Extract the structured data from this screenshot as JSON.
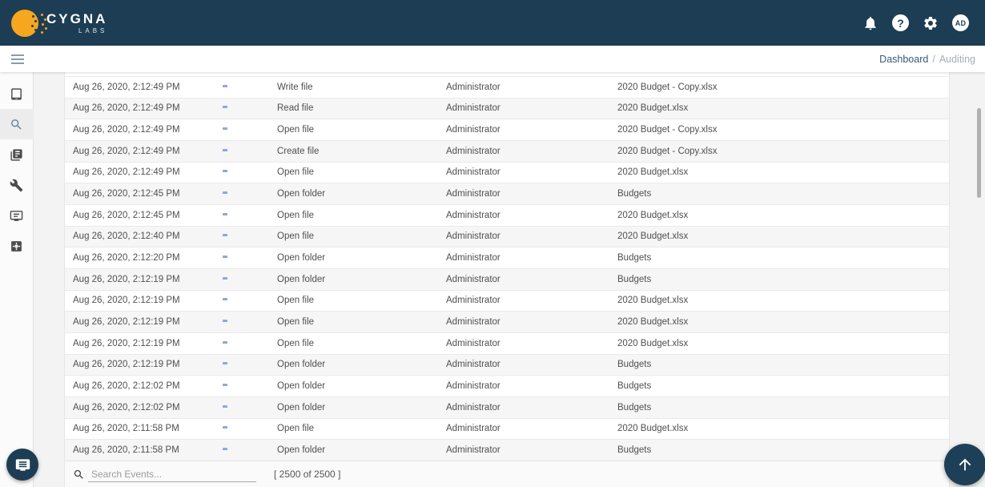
{
  "brand": {
    "primary": "CYGNA",
    "secondary": "LABS"
  },
  "topbar": {
    "help_glyph": "?",
    "avatar_label": "AD"
  },
  "breadcrumb": {
    "parent": "Dashboard",
    "separator": "/",
    "current": "Auditing"
  },
  "sidebar": {
    "items": [
      {
        "name": "devices",
        "active": false
      },
      {
        "name": "search",
        "active": true
      },
      {
        "name": "documents",
        "active": false
      },
      {
        "name": "tools",
        "active": false
      },
      {
        "name": "console",
        "active": false
      },
      {
        "name": "apps",
        "active": false
      }
    ]
  },
  "events": {
    "rows": [
      {
        "time": "Aug 26, 2020, 2:12:49 PM",
        "action": "Write file",
        "user": "Administrator",
        "target": "2020 Budget - Copy.xlsx"
      },
      {
        "time": "Aug 26, 2020, 2:12:49 PM",
        "action": "Read file",
        "user": "Administrator",
        "target": "2020 Budget.xlsx"
      },
      {
        "time": "Aug 26, 2020, 2:12:49 PM",
        "action": "Open file",
        "user": "Administrator",
        "target": "2020 Budget - Copy.xlsx"
      },
      {
        "time": "Aug 26, 2020, 2:12:49 PM",
        "action": "Create file",
        "user": "Administrator",
        "target": "2020 Budget - Copy.xlsx"
      },
      {
        "time": "Aug 26, 2020, 2:12:49 PM",
        "action": "Open file",
        "user": "Administrator",
        "target": "2020 Budget.xlsx"
      },
      {
        "time": "Aug 26, 2020, 2:12:45 PM",
        "action": "Open folder",
        "user": "Administrator",
        "target": "Budgets"
      },
      {
        "time": "Aug 26, 2020, 2:12:45 PM",
        "action": "Open file",
        "user": "Administrator",
        "target": "2020 Budget.xlsx"
      },
      {
        "time": "Aug 26, 2020, 2:12:40 PM",
        "action": "Open file",
        "user": "Administrator",
        "target": "2020 Budget.xlsx"
      },
      {
        "time": "Aug 26, 2020, 2:12:20 PM",
        "action": "Open folder",
        "user": "Administrator",
        "target": "Budgets"
      },
      {
        "time": "Aug 26, 2020, 2:12:19 PM",
        "action": "Open folder",
        "user": "Administrator",
        "target": "Budgets"
      },
      {
        "time": "Aug 26, 2020, 2:12:19 PM",
        "action": "Open file",
        "user": "Administrator",
        "target": "2020 Budget.xlsx"
      },
      {
        "time": "Aug 26, 2020, 2:12:19 PM",
        "action": "Open file",
        "user": "Administrator",
        "target": "2020 Budget.xlsx"
      },
      {
        "time": "Aug 26, 2020, 2:12:19 PM",
        "action": "Open file",
        "user": "Administrator",
        "target": "2020 Budget.xlsx"
      },
      {
        "time": "Aug 26, 2020, 2:12:19 PM",
        "action": "Open folder",
        "user": "Administrator",
        "target": "Budgets"
      },
      {
        "time": "Aug 26, 2020, 2:12:02 PM",
        "action": "Open folder",
        "user": "Administrator",
        "target": "Budgets"
      },
      {
        "time": "Aug 26, 2020, 2:12:02 PM",
        "action": "Open folder",
        "user": "Administrator",
        "target": "Budgets"
      },
      {
        "time": "Aug 26, 2020, 2:11:58 PM",
        "action": "Open file",
        "user": "Administrator",
        "target": "2020 Budget.xlsx"
      },
      {
        "time": "Aug 26, 2020, 2:11:58 PM",
        "action": "Open folder",
        "user": "Administrator",
        "target": "Budgets"
      }
    ]
  },
  "search": {
    "placeholder": "Search Events...",
    "count": "[ 2500 of 2500 ]"
  },
  "colors": {
    "topbar_navy": "#1d3d54",
    "brand_orange": "#f6a71e",
    "folder_blue": "#3d65c2",
    "active_item_bg": "#ececec"
  }
}
